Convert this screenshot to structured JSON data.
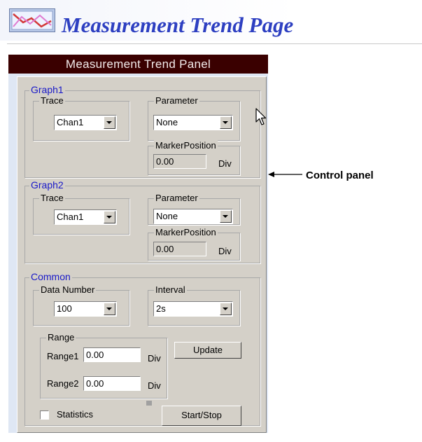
{
  "page": {
    "title": "Measurement Trend Page",
    "logo_icon": "trend-chart-icon"
  },
  "panel": {
    "title": "Measurement Trend Panel",
    "graph1": {
      "label": "Graph1",
      "trace": {
        "label": "Trace",
        "value": "Chan1"
      },
      "parameter": {
        "label": "Parameter",
        "value": "None"
      },
      "marker": {
        "label": "MarkerPosition",
        "value": "0.00",
        "unit": "Div"
      }
    },
    "graph2": {
      "label": "Graph2",
      "trace": {
        "label": "Trace",
        "value": "Chan1"
      },
      "parameter": {
        "label": "Parameter",
        "value": "None"
      },
      "marker": {
        "label": "MarkerPosition",
        "value": "0.00",
        "unit": "Div"
      }
    },
    "common": {
      "label": "Common",
      "data_number": {
        "label": "Data Number",
        "value": "100"
      },
      "interval": {
        "label": "Interval",
        "value": "2s"
      },
      "range": {
        "label": "Range",
        "range1": {
          "label": "Range1",
          "value": "0.00",
          "unit": "Div"
        },
        "range2": {
          "label": "Range2",
          "value": "0.00",
          "unit": "Div"
        }
      },
      "update_label": "Update",
      "statistics_label": "Statistics",
      "statistics_checked": false,
      "start_stop_label": "Start/Stop"
    }
  },
  "annotation": {
    "label": "Control panel"
  },
  "colors": {
    "title_text": "#2d3fc1",
    "titlebar_bg": "#3a0000",
    "group_label": "#1919c8",
    "panel_bg": "#d4d0c8"
  }
}
